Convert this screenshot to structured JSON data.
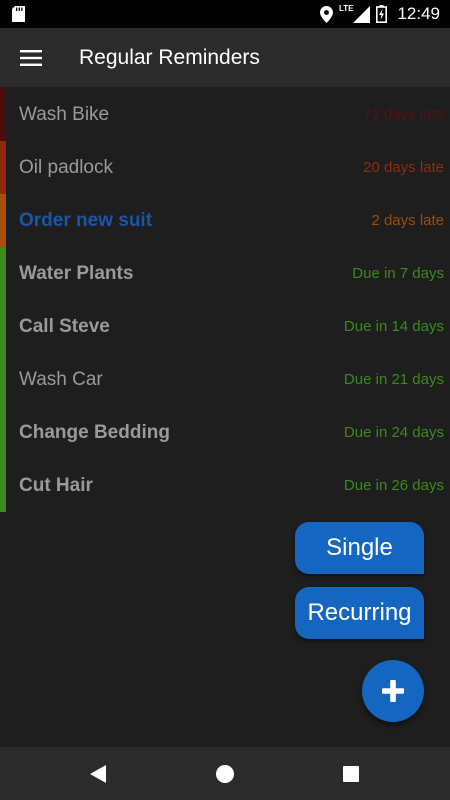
{
  "status_bar": {
    "network": "LTE",
    "time": "12:49"
  },
  "toolbar": {
    "title": "Regular Reminders"
  },
  "reminders": [
    {
      "title": "Wash Bike",
      "due": "71 days late",
      "bar_color": "#4a0c0c",
      "due_color": "#5e0f0f",
      "style": "normal"
    },
    {
      "title": "Oil padlock",
      "due": "20 days late",
      "bar_color": "#8c2a0c",
      "due_color": "#8f2c0e",
      "style": "normal"
    },
    {
      "title": "Order new suit",
      "due": "2 days late",
      "bar_color": "#a8500a",
      "due_color": "#9a4e0c",
      "style": "blue"
    },
    {
      "title": "Water Plants",
      "due": "Due in 7 days",
      "bar_color": "#3d8a1e",
      "due_color": "#3a8a1c",
      "style": "bold"
    },
    {
      "title": "Call Steve",
      "due": "Due in 14 days",
      "bar_color": "#3d8a1e",
      "due_color": "#3a8a1c",
      "style": "bold"
    },
    {
      "title": "Wash Car",
      "due": "Due in 21 days",
      "bar_color": "#3d8a1e",
      "due_color": "#3a8a1c",
      "style": "normal"
    },
    {
      "title": "Change Bedding",
      "due": "Due in 24 days",
      "bar_color": "#3d8a1e",
      "due_color": "#3a8a1c",
      "style": "bold"
    },
    {
      "title": "Cut Hair",
      "due": "Due in 26 days",
      "bar_color": "#3d8a1e",
      "due_color": "#3a8a1c",
      "style": "bold"
    }
  ],
  "fab_menu": {
    "single_label": "Single",
    "recurring_label": "Recurring"
  },
  "icons": {
    "menu": "hamburger-menu-icon",
    "fab": "plus-icon",
    "nav": [
      "back-triangle-icon",
      "home-circle-icon",
      "recents-square-icon"
    ]
  },
  "colors": {
    "accent": "#1566c0",
    "background": "#1e1e1e",
    "toolbar": "#2b2b2b"
  }
}
